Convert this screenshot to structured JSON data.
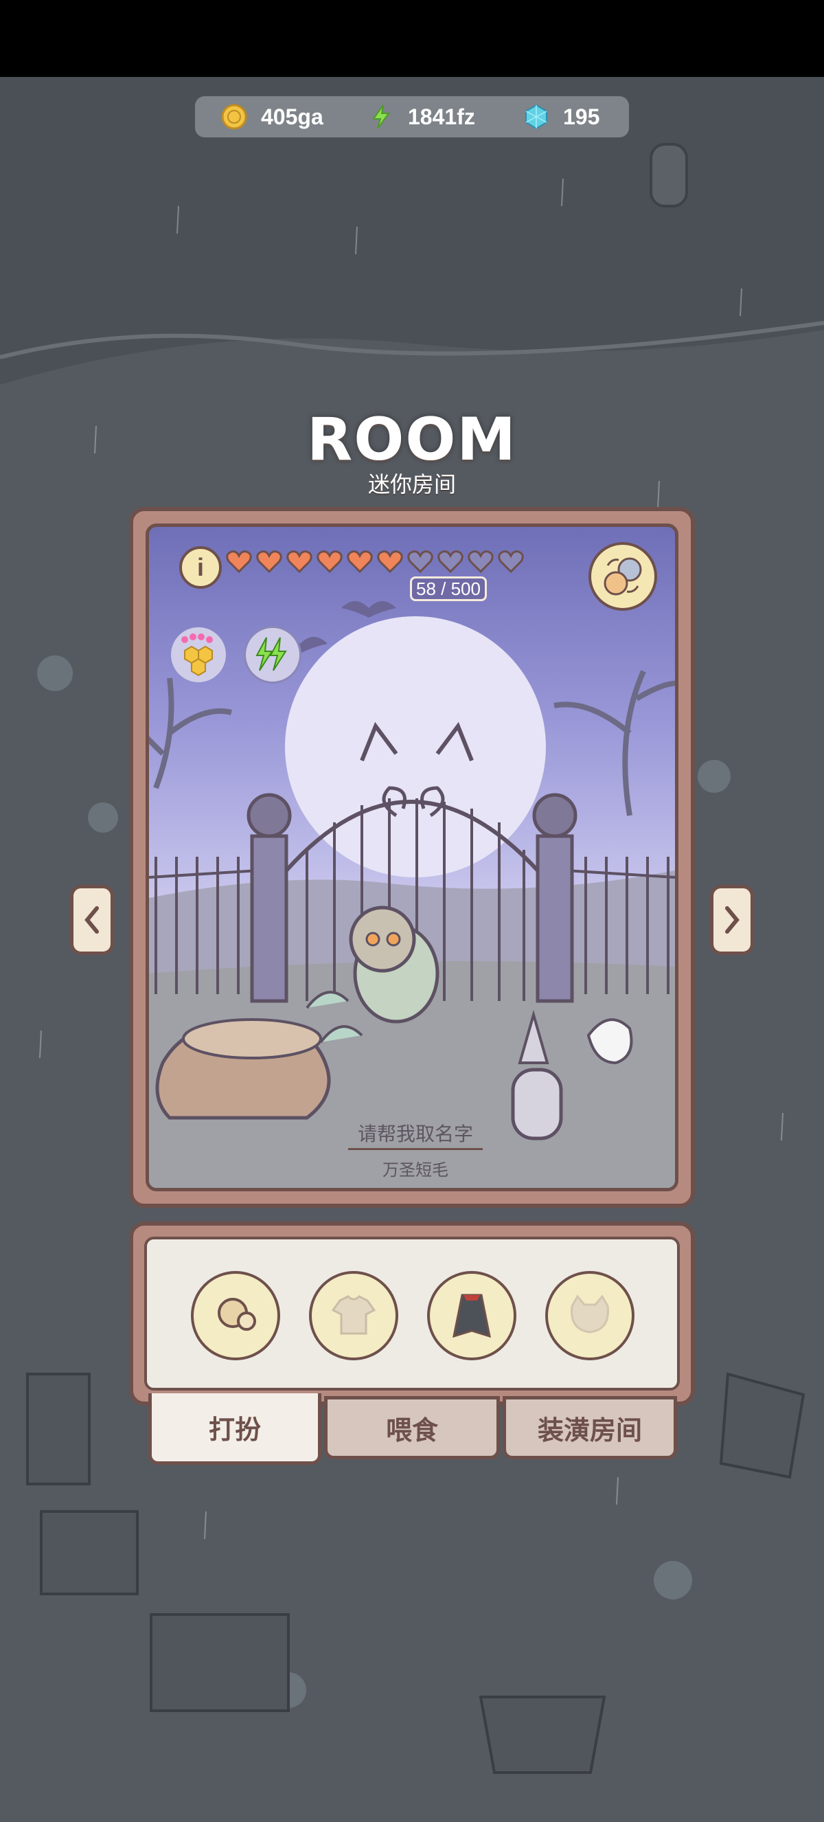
{
  "currency": {
    "gold": "405ga",
    "energy": "1841fz",
    "gems": "195"
  },
  "title": "ROOM",
  "subtitle": "迷你房间",
  "pet": {
    "hearts_filled": 6,
    "hearts_total": 10,
    "hp_text": "58 / 500",
    "name_prompt": "请帮我取名字",
    "breed": "万圣短毛"
  },
  "tabs": {
    "dress": "打扮",
    "feed": "喂食",
    "decorate": "装潢房间"
  },
  "icons": {
    "gold": "coin-icon",
    "energy": "lightning-icon",
    "gems": "gem-icon",
    "info": "info-icon",
    "swap": "cat-swap-icon",
    "left": "chevron-left-icon",
    "right": "chevron-right-icon"
  },
  "colors": {
    "heart_filled": "#f0845a",
    "heart_empty": "#8a88b8",
    "frame": "#6e504b",
    "accent_panel": "#b78a80"
  }
}
